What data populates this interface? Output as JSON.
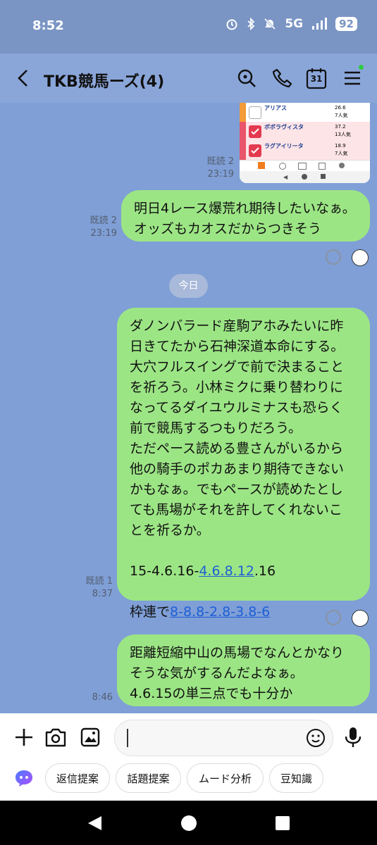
{
  "status": {
    "time": "8:52",
    "network": "5G",
    "battery": "92"
  },
  "header": {
    "back_label": "<",
    "title": "TKB競馬ーズ(4)",
    "calendar_day": "31"
  },
  "thumbnail": {
    "rows": [
      {
        "name": "アリアス",
        "odds": "26.6",
        "pop": "7人気",
        "checked": false
      },
      {
        "name": "ボボラヴィスタ",
        "odds": "37.2",
        "pop": "13人気",
        "checked": true
      },
      {
        "name": "ラグアイリータ",
        "odds": "18.9",
        "pop": "7人気",
        "checked": true
      }
    ],
    "meta_read": "既読 2",
    "meta_time": "23:19"
  },
  "messages": [
    {
      "lines": [
        "明日4レース爆荒れ期待したいなぁ。",
        "オッズもカオスだからつきそう"
      ],
      "read": "既読 2",
      "time": "23:19"
    },
    {
      "lines": [
        "ダノンバラード産駒アホみたいに昨",
        "日きてたから石神深道本命にする。",
        "大穴フルスイングで前で決まること",
        "を祈ろう。小林ミクに乗り替わりに",
        "なってるダイユウルミナスも恐らく",
        "前で競馬するつもりだろう。",
        "ただペース読める豊さんがいるから",
        "他の騎手のポカあまり期待できない",
        "かもなぁ。でもペースが読めたとし",
        "ても馬場がそれを許してくれないこ",
        "とを祈るか。"
      ],
      "bet1_prefix": "15-4.6.16-",
      "bet1_link": "4.6.8.12",
      "bet1_suffix": ".16",
      "bet2_prefix": "枠連で",
      "bet2_link": "8-8.8-2.8-3.8-6",
      "read": "既読 1",
      "time": "8:37"
    },
    {
      "lines": [
        "距離短縮中山の馬場でなんとかなり",
        "そうな気がするんだよなぁ。",
        "4.6.15の単三点でも十分か"
      ],
      "time": "8:46"
    }
  ],
  "date_chip": "今日",
  "input": {
    "placeholder": ""
  },
  "suggestions": [
    "返信提案",
    "話題提案",
    "ムード分析",
    "豆知識"
  ],
  "colors": {
    "bubble": "#9ce585",
    "chat_bg": "#7f9fd6",
    "header": "#8aa6d9",
    "link": "#1e5fd6"
  }
}
